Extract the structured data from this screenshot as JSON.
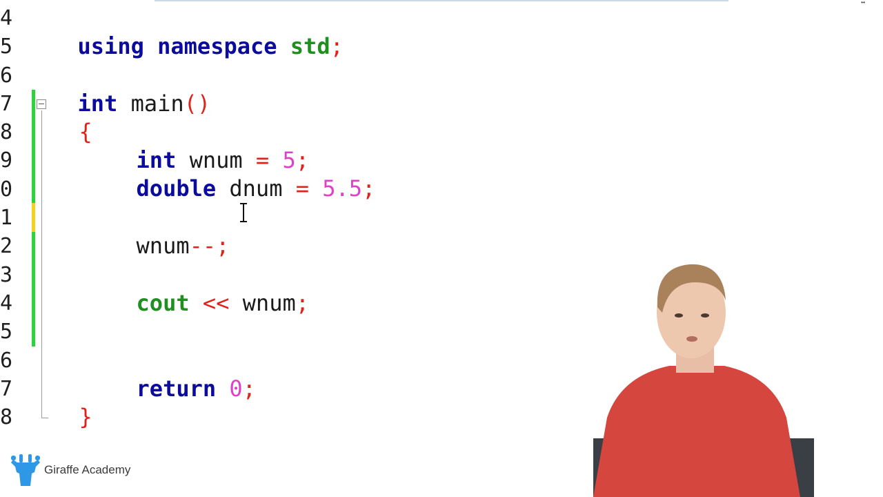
{
  "gutter": {
    "line_numbers": [
      "4",
      "5",
      "6",
      "7",
      "8",
      "9",
      "0",
      "1",
      "2",
      "3",
      "4",
      "5",
      "6",
      "7",
      "8"
    ]
  },
  "code": {
    "line4": {
      "kw1": "using",
      "kw2": "namespace",
      "ident": "std",
      "semi": ";"
    },
    "line6": {
      "kw": "int",
      "ident": "main",
      "parens": "()"
    },
    "line7": {
      "brace": "{"
    },
    "line8": {
      "kw": "int",
      "ident": "wnum",
      "op": "=",
      "num": "5",
      "semi": ";"
    },
    "line9": {
      "kw": "double",
      "ident": "dnum",
      "op": "=",
      "num": "5.5",
      "semi": ";"
    },
    "line11": {
      "ident": "wnum",
      "op": "--",
      "semi": ";"
    },
    "line13": {
      "kw": "cout",
      "op": "<<",
      "ident": "wnum",
      "semi": ";"
    },
    "line16": {
      "kw": "return",
      "num": "0",
      "semi": ";"
    },
    "line17": {
      "brace": "}"
    }
  },
  "brand": {
    "label": "Giraffe Academy",
    "icon": "giraffe-icon",
    "color": "#2e97e6"
  },
  "colors": {
    "keyword": "#0b0b9c",
    "keyword_green": "#1f8f1f",
    "number": "#e040c8",
    "operator": "#e0221a",
    "change_saved": "#2bd43b",
    "change_unsaved": "#f2d21b"
  }
}
